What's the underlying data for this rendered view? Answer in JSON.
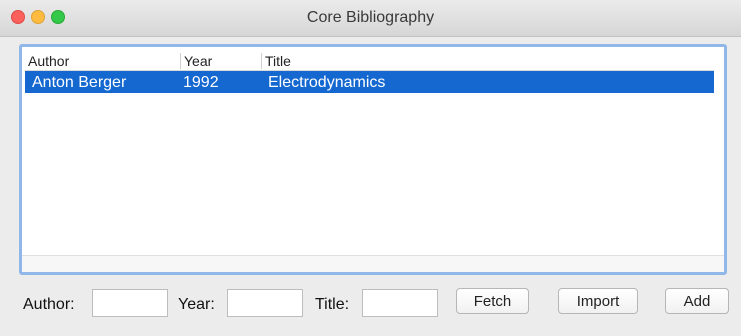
{
  "window": {
    "title": "Core Bibliography"
  },
  "table": {
    "columns": [
      "Author",
      "Year",
      "Title"
    ],
    "rows": [
      {
        "author": "Anton Berger",
        "year": "1992",
        "title": "Electrodynamics",
        "selected": true
      }
    ]
  },
  "form": {
    "author_label": "Author:",
    "year_label": "Year:",
    "title_label": "Title:",
    "author_value": "",
    "year_value": "",
    "title_value": ""
  },
  "buttons": {
    "fetch": "Fetch",
    "import": "Import",
    "add": "Add"
  },
  "colors": {
    "selection": "#1468d0",
    "focus_ring": "#8fb7e8"
  }
}
